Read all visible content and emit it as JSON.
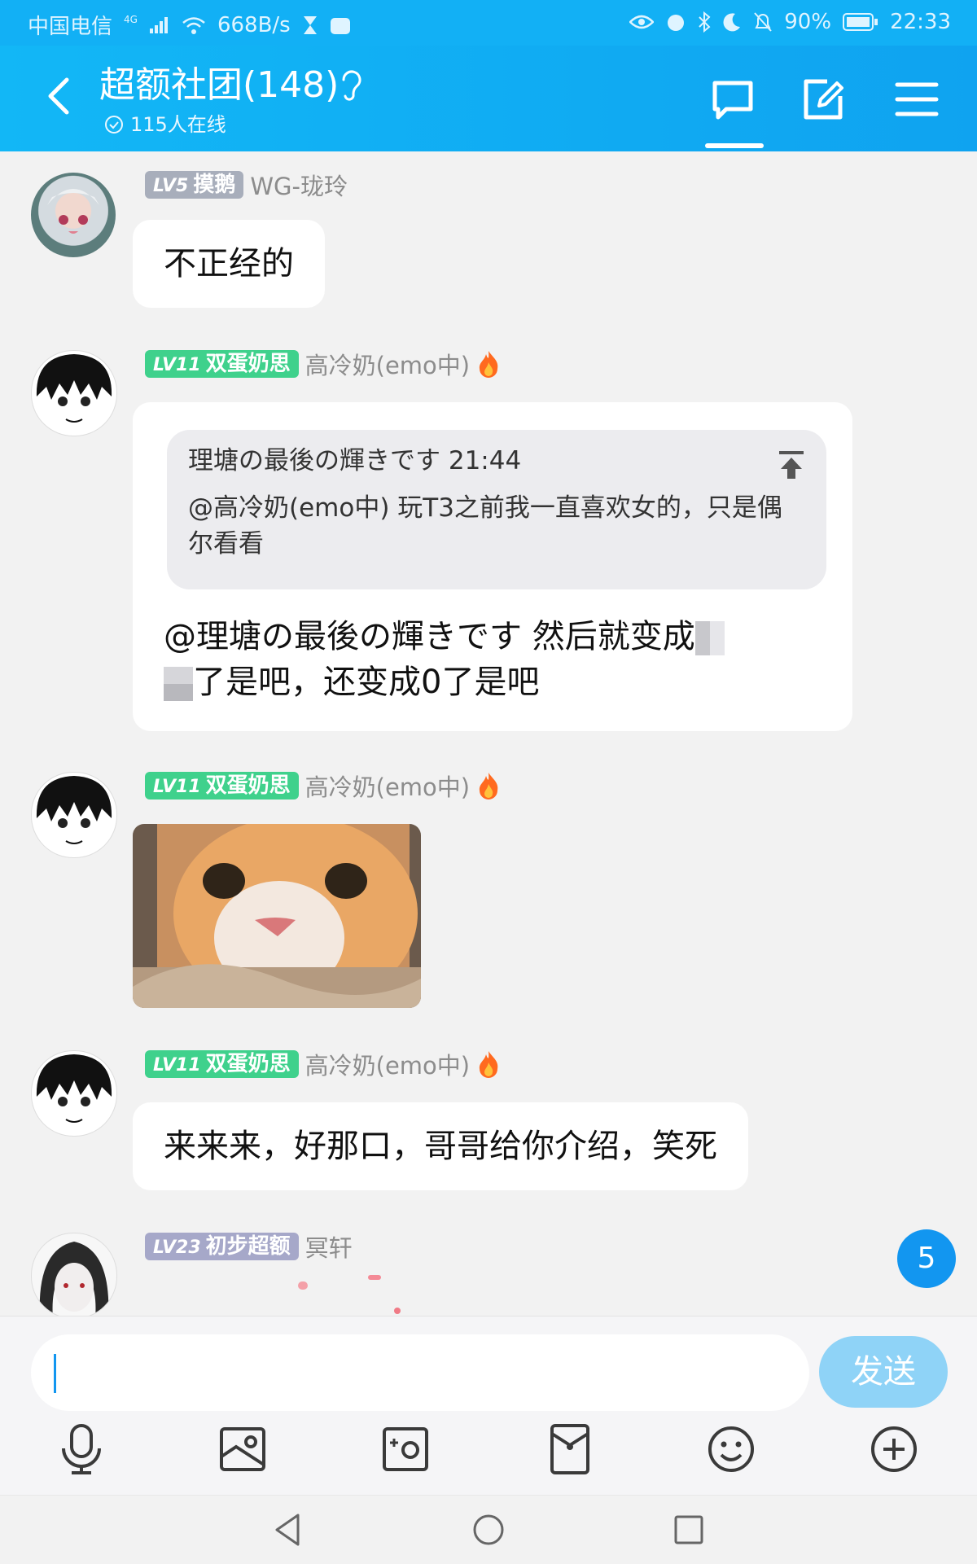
{
  "status_bar": {
    "carrier": "中国电信",
    "network": "4G",
    "speed": "668B/s",
    "battery": "90%",
    "time": "22:33"
  },
  "header": {
    "title": "超额社团(148)",
    "online": "115人在线"
  },
  "messages": [
    {
      "badge_level": "LV5",
      "badge_title": "摸鹅",
      "username": "WG-珑玲",
      "text": "不正经的"
    },
    {
      "badge_level": "LV11",
      "badge_title": "双蛋奶思",
      "username": "高冷奶(emo中)",
      "quote_header": "理塘の最後の輝きです 21:44",
      "quote_text": "@高冷奶(emo中) 玩T3之前我一直喜欢女的，只是偶尔看看",
      "text_line1": "@理塘の最後の輝きです 然后就变成",
      "text_line2": "了是吧，还变成0了是吧"
    },
    {
      "badge_level": "LV11",
      "badge_title": "双蛋奶思",
      "username": "高冷奶(emo中)"
    },
    {
      "badge_level": "LV11",
      "badge_title": "双蛋奶思",
      "username": "高冷奶(emo中)",
      "text": "来来来，好那口，哥哥给你介绍，笑死"
    },
    {
      "badge_level": "LV23",
      "badge_title": "初步超额",
      "username": "冥轩"
    }
  ],
  "unread_count": "5",
  "input": {
    "send_label": "发送"
  },
  "colors": {
    "header": "#12b0f5",
    "badge_green": "#3fd18c",
    "badge_gray": "#a8aebb",
    "send_button": "#8fd3f7",
    "unread_badge": "#1296f0"
  }
}
